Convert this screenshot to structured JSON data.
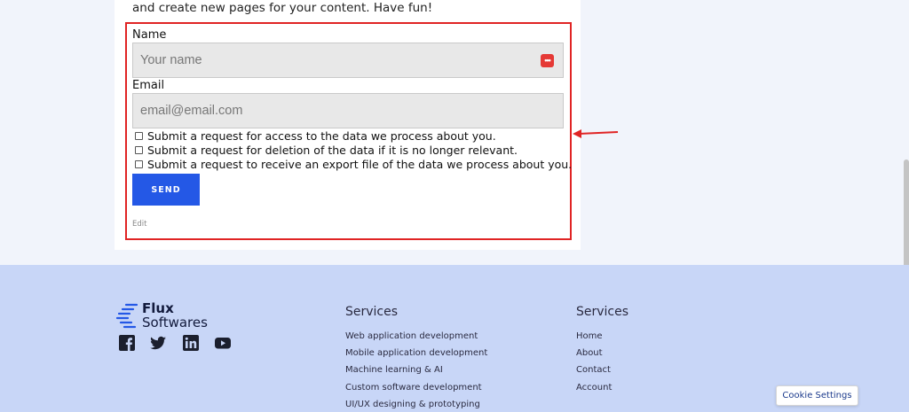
{
  "intro": {
    "text": "and create new pages for your content. Have fun!"
  },
  "form": {
    "name_label": "Name",
    "name_placeholder": "Your name",
    "email_label": "Email",
    "email_placeholder": "email@email.com",
    "checkboxes": [
      {
        "label": "Submit a request for access to the data we process about you.",
        "checked": false
      },
      {
        "label": "Submit a request for deletion of the data if it is no longer relevant.",
        "checked": false
      },
      {
        "label": "Submit a request to receive an export file of the data we process about you.",
        "checked": false
      }
    ],
    "send_label": "SEND",
    "edit_label": "Edit",
    "password_manager_icon": "password-manager-icon"
  },
  "footer": {
    "logo": {
      "line1": "Flux",
      "line2": "Softwares"
    },
    "social_icons": [
      "facebook-icon",
      "twitter-icon",
      "linkedin-icon",
      "youtube-icon"
    ],
    "col1": {
      "title": "Services",
      "links": [
        "Web application development",
        "Mobile application development",
        "Machine learning & AI",
        "Custom software development",
        "UI/UX designing & prototyping"
      ]
    },
    "col2": {
      "title": "Services",
      "links": [
        "Home",
        "About",
        "Contact",
        "Account"
      ]
    }
  },
  "cookie": {
    "label": "Cookie Settings"
  },
  "colors": {
    "highlight": "#e02424",
    "button": "#2458e6",
    "footer_bg": "#c8d6f7",
    "page_bg": "#f1f4fb"
  }
}
